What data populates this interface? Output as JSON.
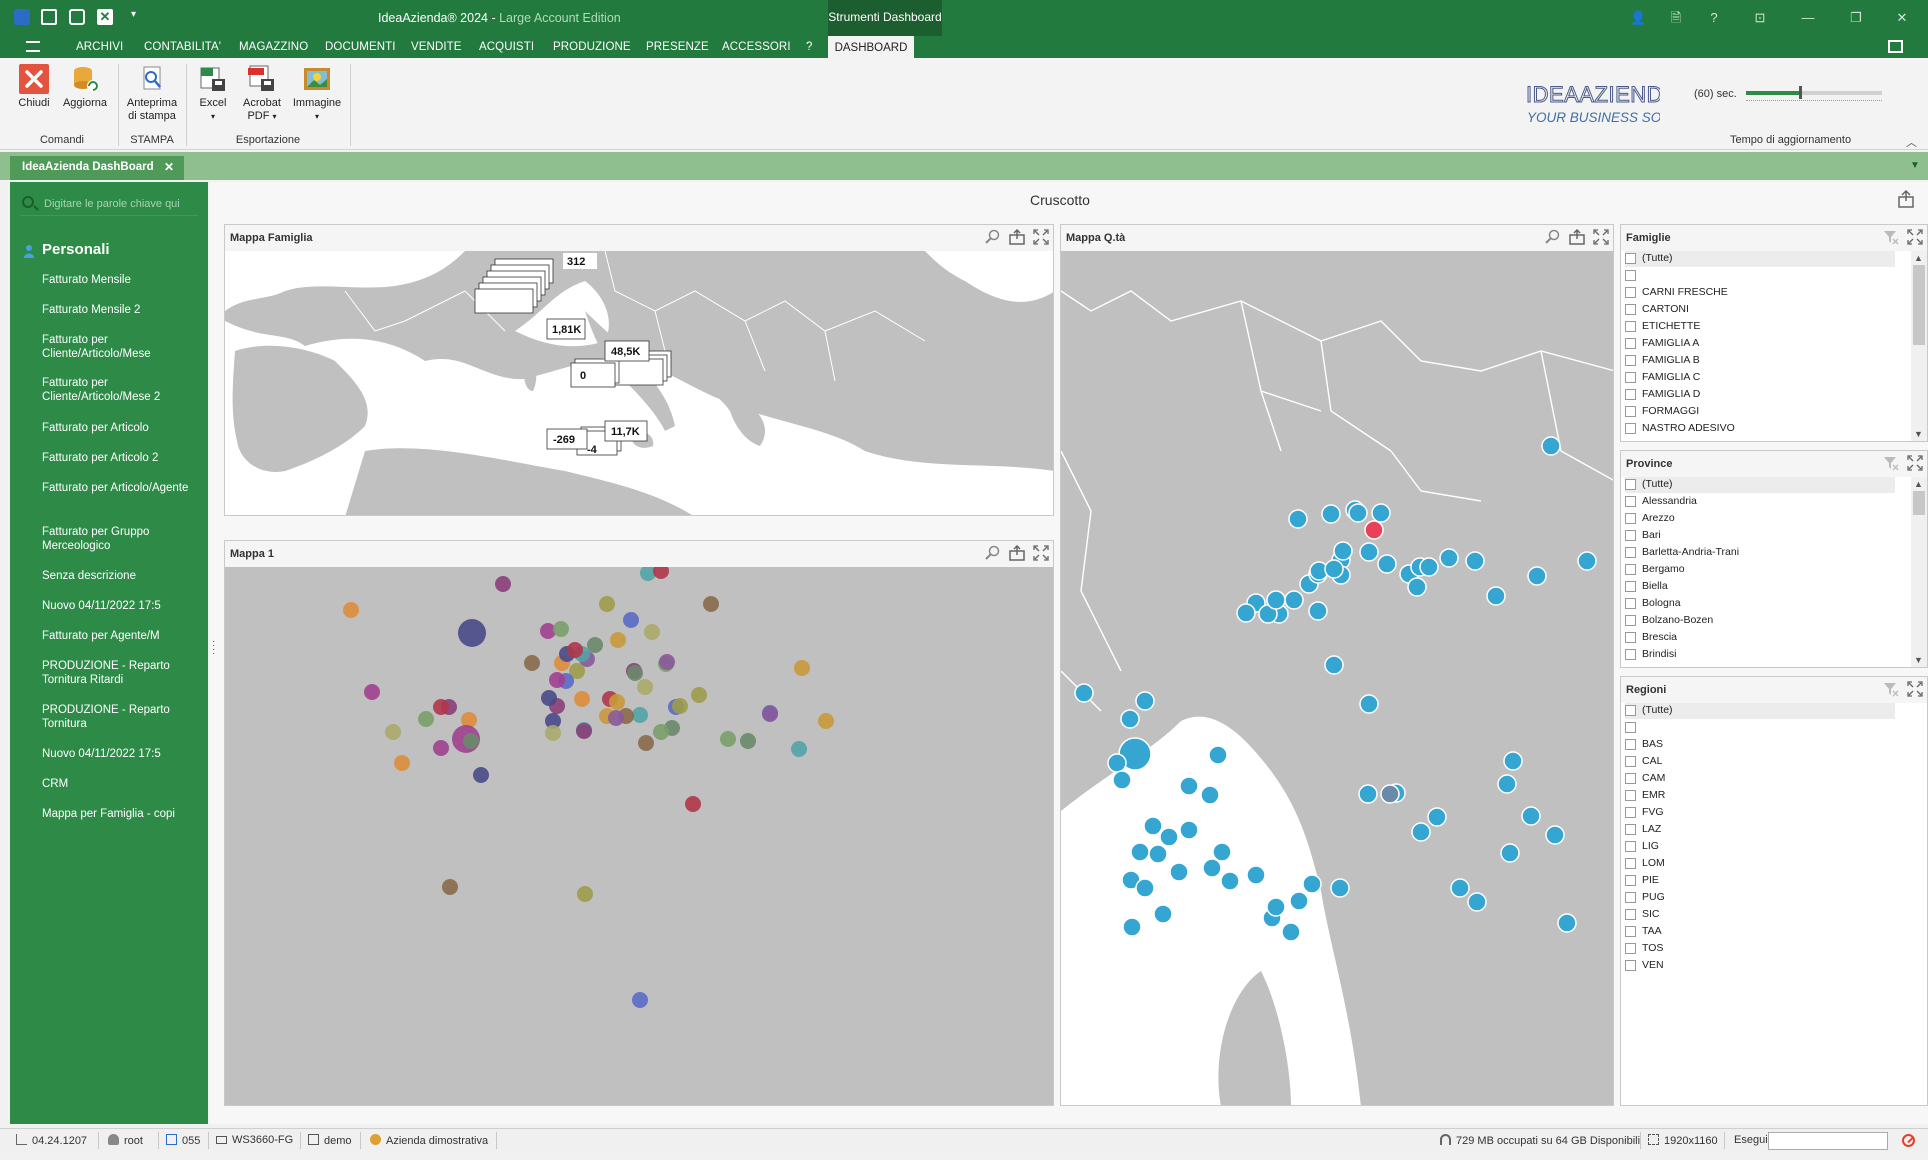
{
  "window": {
    "title": "IdeaAzienda® 2024 - ",
    "edition": "Large Account Edition",
    "context_tab": "Strumenti Dashboard"
  },
  "ribbon_tabs": [
    "ARCHIVI",
    "CONTABILITA'",
    "MAGAZZINO",
    "DOCUMENTI",
    "VENDITE",
    "ACQUISTI",
    "PRODUZIONE",
    "PRESENZE",
    "ACCESSORI",
    "?"
  ],
  "active_tab": "DASHBOARD",
  "ribbon": {
    "close": "Chiudi",
    "refresh": "Aggiorna",
    "preview_1": "Anteprima",
    "preview_2": "di stampa",
    "excel": "Excel",
    "acrobat_1": "Acrobat",
    "acrobat_2": "PDF",
    "image": "Immagine",
    "group_commands": "Comandi",
    "group_print": "STAMPA",
    "group_export": "Esportazione",
    "refresh_interval": "(60) sec.",
    "refresh_interval_fraction": 0.4,
    "refresh_group": "Tempo di aggiornamento",
    "brand_line1": "IDEAAZIENDA",
    "brand_line2": "YOUR BUSINESS SOLUTION"
  },
  "doc_tab": "IdeaAzienda DashBoard",
  "sidebar": {
    "search_placeholder": "Digitare le parole chiave qui",
    "group": "Personali",
    "items": [
      "Fatturato Mensile",
      "Fatturato Mensile 2",
      "Fatturato per Cliente/Articolo/Mese",
      "Fatturato per Cliente/Articolo/Mese 2",
      "Fatturato per Articolo",
      "Fatturato per Articolo 2",
      "Fatturato per Articolo/Agente",
      "Fatturato per Gruppo Merceologico",
      "Senza descrizione",
      "Nuovo 04/11/2022 17:5",
      "Fatturato per Agente/M",
      "PRODUZIONE - Reparto Tornitura Ritardi",
      "PRODUZIONE - Reparto Tornitura",
      "Nuovo 04/11/2022 17:5",
      "CRM",
      "Mappa per Famiglia - copi"
    ]
  },
  "dashboard": {
    "title": "Cruscotto",
    "panels": {
      "mappa_famiglia": "Mappa Famiglia",
      "mappa_1": "Mappa 1",
      "mappa_qta": "Mappa Q.tà",
      "famiglie": "Famiglie",
      "province": "Province",
      "regioni": "Regioni"
    },
    "famiglia_labels": [
      "312",
      "1,81K",
      "48,5K",
      "11,7K",
      "-269",
      "0",
      "-4"
    ],
    "famiglie_items": [
      "(Tutte)",
      "",
      "CARNI FRESCHE",
      "CARTONI",
      "ETICHETTE",
      "FAMIGLIA A",
      "FAMIGLIA B",
      "FAMIGLIA C",
      "FAMIGLIA D",
      "FORMAGGI",
      "NASTRO ADESIVO"
    ],
    "province_items": [
      "(Tutte)",
      "Alessandria",
      "Arezzo",
      "Bari",
      "Barletta-Andria-Trani",
      "Bergamo",
      "Biella",
      "Bologna",
      "Bolzano-Bozen",
      "Brescia",
      "Brindisi"
    ],
    "regioni_items": [
      "(Tutte)",
      "",
      "BAS",
      "CAL",
      "CAM",
      "EMR",
      "FVG",
      "LAZ",
      "LIG",
      "LOM",
      "PIE",
      "PUG",
      "SIC",
      "TAA",
      "TOS",
      "VEN"
    ]
  },
  "statusbar": {
    "version": "04.24.1207",
    "user": "root",
    "company_code": "055",
    "workstation": "WS3660-FG",
    "database": "demo",
    "company": "Azienda dimostrativa",
    "memory": "729 MB occupati su 64 GB Disponibili",
    "resolution": "1920x1160",
    "execute": "Esegui"
  },
  "colors": {
    "title_green": "#237a3e",
    "sidebar_green": "#2e8b47",
    "map_land": "#c0c0c0",
    "map_water": "#ffffff",
    "bubble_blue": "#34a6d1",
    "bubble_red": "#e8425a"
  }
}
